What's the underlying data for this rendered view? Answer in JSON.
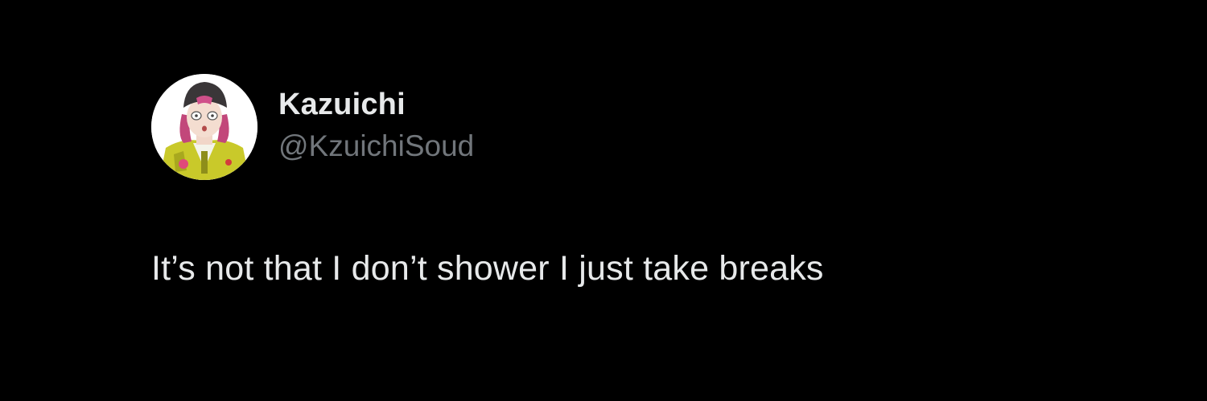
{
  "tweet": {
    "author": {
      "display_name": "Kazuichi",
      "handle": "@KzuichiSoud",
      "avatar_icon": "avatar-image"
    },
    "text": "It’s not that I don’t shower I just take breaks"
  },
  "colors": {
    "background": "#000000",
    "primary_text": "#e7e9ea",
    "secondary_text": "#71767b"
  }
}
